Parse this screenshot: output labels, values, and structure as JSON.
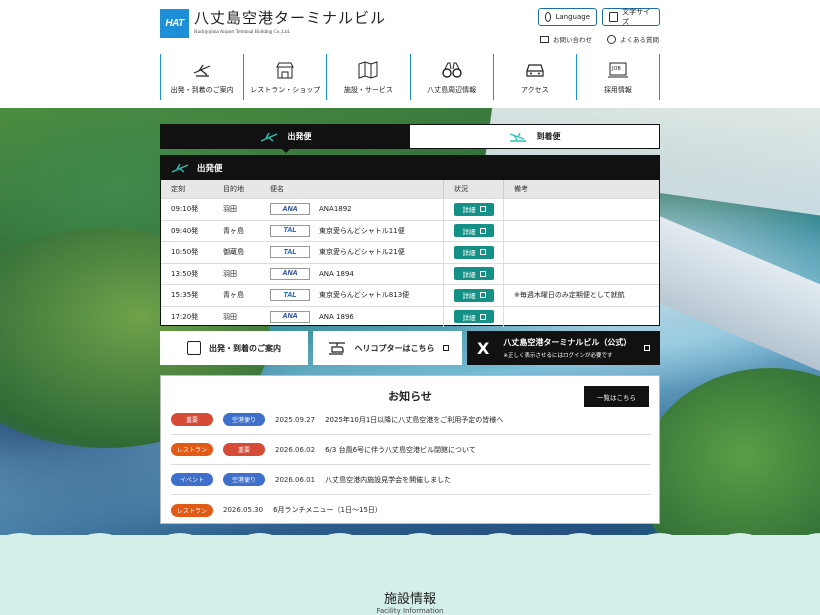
{
  "header": {
    "logo_mark": "HAT",
    "logo_jp": "八丈島空港ターミナルビル",
    "logo_en": "Hachijojima Airport Terminal Building Co.,Ltd.",
    "language_label": "Language",
    "font_size_label": "文字サイズ",
    "contact_label": "お問い合わせ",
    "faq_label": "よくある質問"
  },
  "gnav": [
    {
      "label": "出発・到着のご案内",
      "icon": "airplane-icon"
    },
    {
      "label": "レストラン・ショップ",
      "icon": "shop-icon"
    },
    {
      "label": "施設・サービス",
      "icon": "map-icon"
    },
    {
      "label": "八丈島周辺情報",
      "icon": "binoculars-icon"
    },
    {
      "label": "アクセス",
      "icon": "car-icon"
    },
    {
      "label": "採用情報",
      "icon": "job-icon"
    }
  ],
  "tabs": {
    "departure": "出発便",
    "arrival": "到着便"
  },
  "board": {
    "title": "出発便",
    "columns": [
      "定刻",
      "目的地",
      "便名",
      "状況",
      "備考"
    ],
    "rows": [
      {
        "time": "09:10発",
        "dest": "羽田",
        "airline": "ANA",
        "flight": "ANA1892",
        "status": "詳細",
        "note": ""
      },
      {
        "time": "09:40発",
        "dest": "青ヶ島",
        "airline": "TAL",
        "flight": "東京愛らんどシャトル11便",
        "status": "詳細",
        "note": ""
      },
      {
        "time": "10:50発",
        "dest": "御蔵島",
        "airline": "TAL",
        "flight": "東京愛らんどシャトル21便",
        "status": "詳細",
        "note": ""
      },
      {
        "time": "13:50発",
        "dest": "羽田",
        "airline": "ANA",
        "flight": "ANA 1894",
        "status": "詳細",
        "note": ""
      },
      {
        "time": "15:35発",
        "dest": "青ヶ島",
        "airline": "TAL",
        "flight": "東京愛らんどシャトル813便",
        "status": "詳細",
        "note": "※毎週木曜日のみ定期便として就航"
      },
      {
        "time": "17:20発",
        "dest": "羽田",
        "airline": "ANA",
        "flight": "ANA 1896",
        "status": "詳細",
        "note": ""
      }
    ]
  },
  "quick_links": {
    "guide": "出発・到着のご案内",
    "heli": "ヘリコプターはこちら",
    "x_title": "八丈島空港ターミナルビル（公式）",
    "x_note": "※正しく表示させるにはログインが必要です",
    "x_logo": "X"
  },
  "news": {
    "title": "お知らせ",
    "more": "一覧はこちら",
    "items": [
      {
        "badges": [
          {
            "text": "重要",
            "color": "#d64a38"
          },
          {
            "text": "空港便り",
            "color": "#3d6fcb"
          }
        ],
        "date": "2025.09.27",
        "text": "2025年10月1日以降に八丈島空港をご利用予定の皆様へ"
      },
      {
        "badges": [
          {
            "text": "レストラン",
            "color": "#e15a16"
          },
          {
            "text": "重要",
            "color": "#d64a38"
          }
        ],
        "date": "2026.06.02",
        "text": "6/3 台風6号に伴う八丈島空港ビル閉館について"
      },
      {
        "badges": [
          {
            "text": "イベント",
            "color": "#3d6fcb"
          },
          {
            "text": "空港便り",
            "color": "#3d6fcb"
          }
        ],
        "date": "2026.06.01",
        "text": "八丈島空港内施設見学会を開催しました"
      },
      {
        "badges": [
          {
            "text": "レストラン",
            "color": "#e15a16"
          }
        ],
        "date": "2026.05.30",
        "text": "6月ランチメニュー（1日〜15日）"
      }
    ]
  },
  "facility": {
    "title": "施設情報",
    "subtitle": "Facility Information"
  }
}
